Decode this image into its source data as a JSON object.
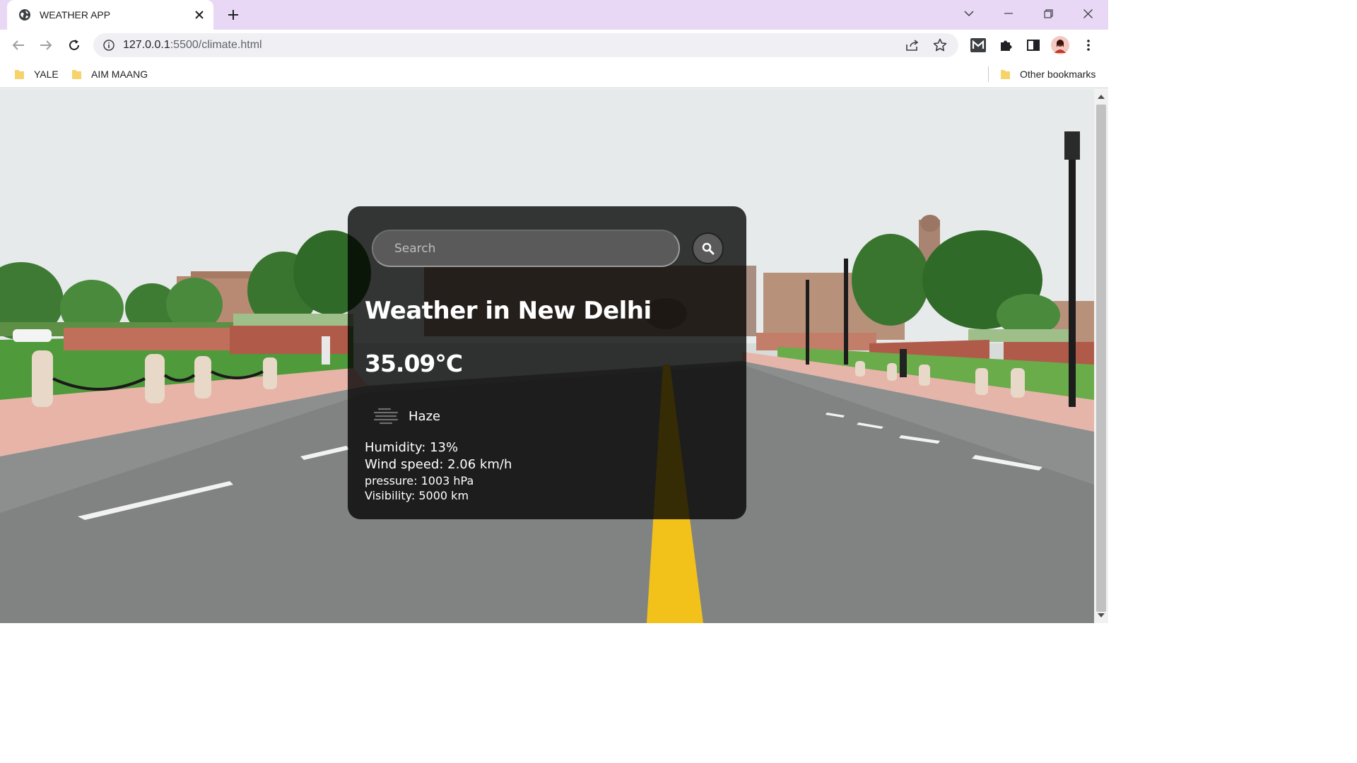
{
  "browser": {
    "tab": {
      "title": "WEATHER APP"
    },
    "address": {
      "host": "127.0.0.1",
      "rest": ":5500/climate.html"
    },
    "bookmarks": [
      {
        "label": "YALE"
      },
      {
        "label": "AIM MAANG"
      }
    ],
    "other_bookmarks": "Other bookmarks"
  },
  "weather": {
    "search": {
      "placeholder": "Search",
      "value": ""
    },
    "city": "Weather in New Delhi",
    "temperature": "35.09°C",
    "description": "Haze",
    "humidity": "Humidity: 13%",
    "wind": "Wind speed: 2.06 km/h",
    "pressure": "pressure: 1003 hPa",
    "visibility": "Visibility: 5000 km"
  },
  "colors": {
    "tab_strip": "#e8d8f6",
    "card_bg": "rgba(0,0,0,0.78)",
    "road_line": "#f2c21a",
    "lawn": "#4f9a3a",
    "sandstone": "#b05a4a"
  }
}
